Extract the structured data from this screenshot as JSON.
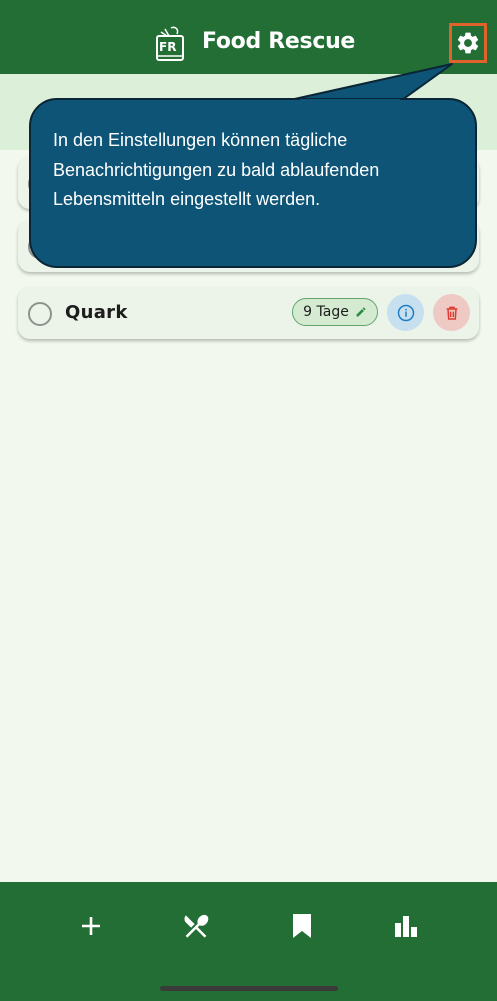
{
  "header": {
    "logo_text": "FR",
    "title": "Food Rescue",
    "settings_icon": "gear-icon"
  },
  "items": [
    {
      "name": "",
      "days_label": ""
    },
    {
      "name": "",
      "days_label": ""
    },
    {
      "name": "Quark",
      "days_label": "9 Tage"
    }
  ],
  "tooltip": {
    "text": "In den Einstellungen können tägliche Benachrichtigungen zu bald ablaufenden Lebensmitteln eingestellt werden."
  },
  "bottom_nav": {
    "items": [
      {
        "icon": "plus-icon"
      },
      {
        "icon": "fork-knife-icon"
      },
      {
        "icon": "bookmark-icon"
      },
      {
        "icon": "bar-chart-icon"
      }
    ]
  },
  "colors": {
    "primary": "#226e35",
    "background": "#f2f8ee",
    "highlight": "#e0632e",
    "tooltip": "#0e5476"
  }
}
